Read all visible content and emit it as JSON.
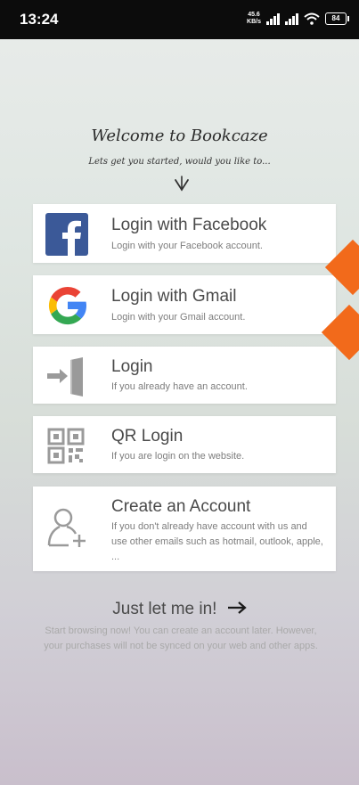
{
  "status_bar": {
    "time": "13:24",
    "net_speed_top": "45.6",
    "net_speed_bottom": "KB/s",
    "battery": "84"
  },
  "welcome": {
    "title": "Welcome to Bookcaze",
    "subtitle": "Lets get you started, would you like to..."
  },
  "options": [
    {
      "title": "Login with Facebook",
      "desc": "Login with your Facebook account.",
      "icon": "facebook-icon"
    },
    {
      "title": "Login with Gmail",
      "desc": "Login with your Gmail account.",
      "icon": "google-icon"
    },
    {
      "title": "Login",
      "desc": "If you already have an account.",
      "icon": "login-door-icon"
    },
    {
      "title": "QR Login",
      "desc": "If you are login on the website.",
      "icon": "qr-code-icon"
    },
    {
      "title": "Create an Account",
      "desc": "If you don't already have account with us and use other emails such as hotmail, outlook, apple, ...",
      "icon": "add-user-icon"
    }
  ],
  "guest": {
    "title": "Just let me in!",
    "desc": "Start browsing now! You can create an account later. However, your purchases will not be synced on your web and other apps."
  },
  "colors": {
    "facebook": "#3b5998",
    "accent_orange": "#f26a1b",
    "icon_gray": "#9a9a9a"
  }
}
